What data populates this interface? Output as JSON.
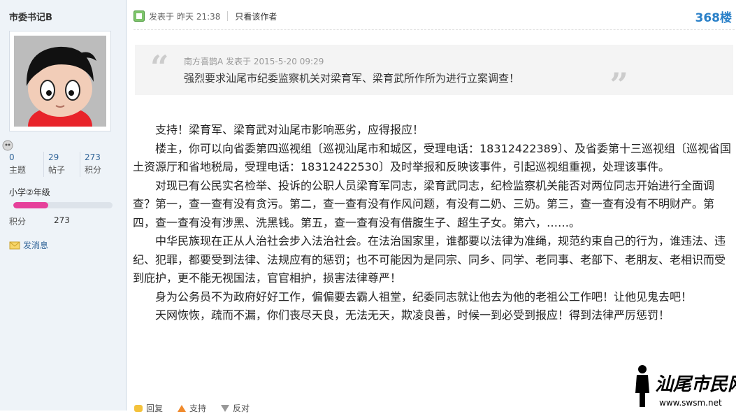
{
  "user": {
    "name": "市委书记B",
    "stats": [
      {
        "value": "0",
        "label": "主题"
      },
      {
        "value": "29",
        "label": "帖子"
      },
      {
        "value": "273",
        "label": "积分"
      }
    ],
    "level": "小学②年级",
    "level_progress": 0.35,
    "points_label": "积分",
    "points_value": "273",
    "message_label": "发消息"
  },
  "post": {
    "posted_label": "发表于",
    "posted_time": "昨天 21:38",
    "author_only": "只看该作者",
    "floor": "368楼",
    "quote": {
      "meta": "南方喜鹊A 发表于 2015-5-20 09:29",
      "text": "强烈要求汕尾市纪委监察机关对梁育军、梁育武所作所为进行立案调查！"
    },
    "paragraphs": [
      {
        "text": "支持！梁育军、梁育武对汕尾市影响恶劣，应得报应！",
        "indent": true
      },
      {
        "text": "楼主，你可以向省委第四巡视组〔巡视汕尾市和城区，受理电话：18312422389〕、及省委第十三巡视组〔巡视省国土资源厅和省地税局，受理电话：18312422530〕及时举报和反映该事件，引起巡视组重视，处理该事件。",
        "indent": true
      },
      {
        "text": "对现已有公民实名检举、投诉的公职人员梁育军同志，梁育武同志，纪检监察机关能否对两位同志开始进行全面调查？第一，查一查有没有贪污。第二，查一查有没有作风问题，有没有二奶、三奶。第三，查一查有没有不明财产。第四，查一查有没有涉黑、洗黑钱。第五，查一查有没有借腹生子、超生子女。第六，……。",
        "indent": true
      },
      {
        "text": "中华民族现在正从人治社会步入法治社会。在法治国家里，谁都要以法律为准绳，规范约束自己的行为，谁违法、违纪、犯罪，都要受到法律、法规应有的惩罚；也不可能因为是同宗、同乡、同学、老同事、老部下、老朋友、老相识而受到庇护，更不能无视国法，官官相护，损害法律尊严！",
        "indent": true
      },
      {
        "text": "身为公务员不为政府好好工作，偏偏要去霸人祖堂，纪委同志就让他去为他的老祖公工作吧！让他见鬼去吧！",
        "indent": true
      },
      {
        "text": "天网恢恢，疏而不漏，你们丧尽天良，无法无天，欺凌良善，时候一到必受到报应！得到法律严厉惩罚！",
        "indent": true
      }
    ],
    "actions": [
      "回复",
      "支持",
      "反对"
    ]
  },
  "watermark": {
    "name": "汕尾市民网",
    "url": "www.swsm.net"
  }
}
